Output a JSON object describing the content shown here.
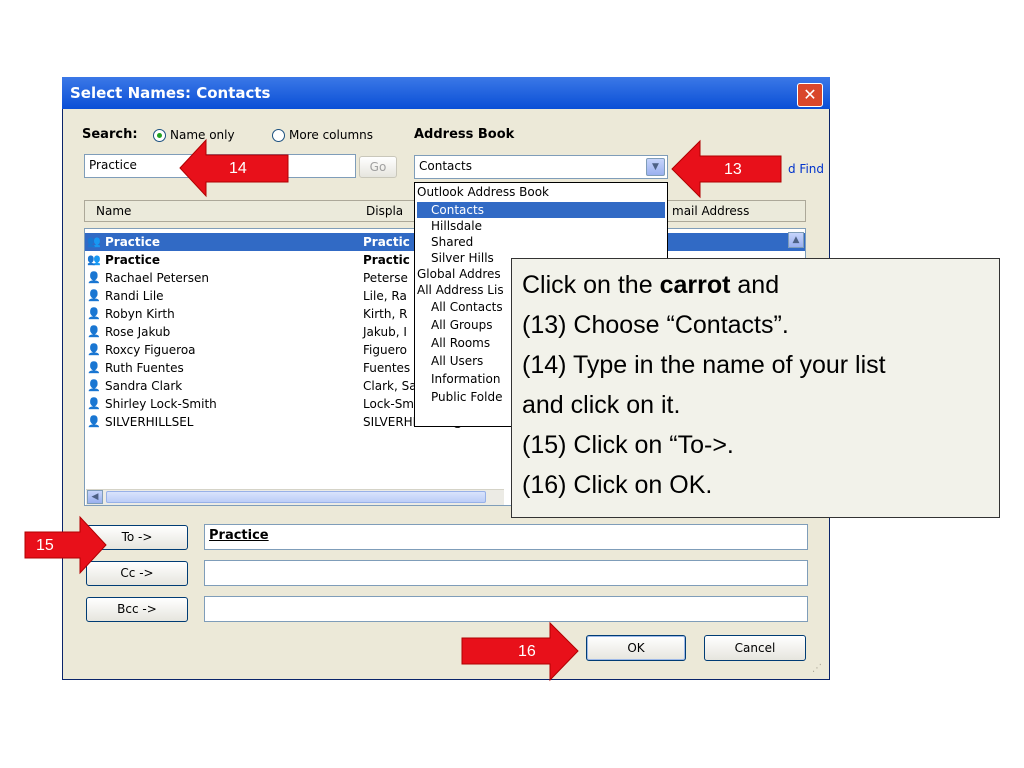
{
  "dialog": {
    "title": "Select Names: Contacts",
    "close_glyph": "✕"
  },
  "search": {
    "label": "Search:",
    "option_name_only": "Name only",
    "option_more_columns": "More columns",
    "selected": "Name only",
    "value": "Practice",
    "go_label": "Go"
  },
  "address_book": {
    "label": "Address Book",
    "selected": "Contacts",
    "advanced_find_visible": "d Find",
    "options": [
      {
        "label": "Outlook Address Book",
        "indent": false
      },
      {
        "label": "Contacts",
        "indent": true,
        "selected": true
      },
      {
        "label": "Hillsdale",
        "indent": true
      },
      {
        "label": "Shared",
        "indent": true
      },
      {
        "label": "Silver Hills",
        "indent": true
      },
      {
        "label": "Global Addres",
        "indent": false
      },
      {
        "label": "All Address Lis",
        "indent": false
      },
      {
        "label": "All Contacts",
        "indent": true
      },
      {
        "label": "All Groups",
        "indent": true
      },
      {
        "label": "All Rooms",
        "indent": true
      },
      {
        "label": "All Users",
        "indent": true
      },
      {
        "label": "Information",
        "indent": true
      },
      {
        "label": "Public Folde",
        "indent": true
      }
    ]
  },
  "columns": {
    "name": "Name",
    "display": "Displa",
    "email": "mail Address"
  },
  "contacts": [
    {
      "name": "Practice",
      "display": "Practic",
      "type": "group",
      "bold": true,
      "selected": true
    },
    {
      "name": "Practice",
      "display": "Practic",
      "type": "group",
      "bold": true
    },
    {
      "name": "Rachael Petersen",
      "display": "Peterse",
      "type": "person"
    },
    {
      "name": "Randi Lile",
      "display": "Lile, Ra",
      "type": "person"
    },
    {
      "name": "Robyn Kirth",
      "display": "Kirth, R",
      "type": "person"
    },
    {
      "name": "Rose Jakub",
      "display": "Jakub, I",
      "type": "person"
    },
    {
      "name": "Roxcy Figueroa",
      "display": "Figuero",
      "type": "person"
    },
    {
      "name": "Ruth Fuentes",
      "display": "Fuentes",
      "type": "person"
    },
    {
      "name": "Sandra Clark",
      "display": "Clark, Sandra (Socialw",
      "type": "person"
    },
    {
      "name": "Shirley Lock-Smith",
      "display": "Lock-Smith, Shirley (sl",
      "type": "person"
    },
    {
      "name": "SILVERHILLSEL",
      "display": "SILVERHILLSEL@LS.G",
      "type": "person"
    }
  ],
  "recipients": {
    "to_label": "To ->",
    "to_value": "Practice",
    "cc_label": "Cc ->",
    "cc_value": "",
    "bcc_label": "Bcc ->",
    "bcc_value": ""
  },
  "actions": {
    "ok": "OK",
    "cancel": "Cancel"
  },
  "annotations": {
    "step13": "13",
    "step14": "14",
    "step15": "15",
    "step16": "16",
    "arrow_color": "#e8101a"
  },
  "callout": {
    "line1_pre": "Click on the ",
    "line1_bold": "carrot",
    "line1_post": " and",
    "line2": "(13) Choose “Contacts”.",
    "line3": "(14) Type in the name of your list",
    "line4": "and click on it.",
    "line5": "(15) Click on “To->.",
    "line6": "(16) Click on OK."
  },
  "colors": {
    "titlebar": "#0a4fd6",
    "selection": "#316ac5",
    "dialog_bg": "#ece9d8"
  }
}
